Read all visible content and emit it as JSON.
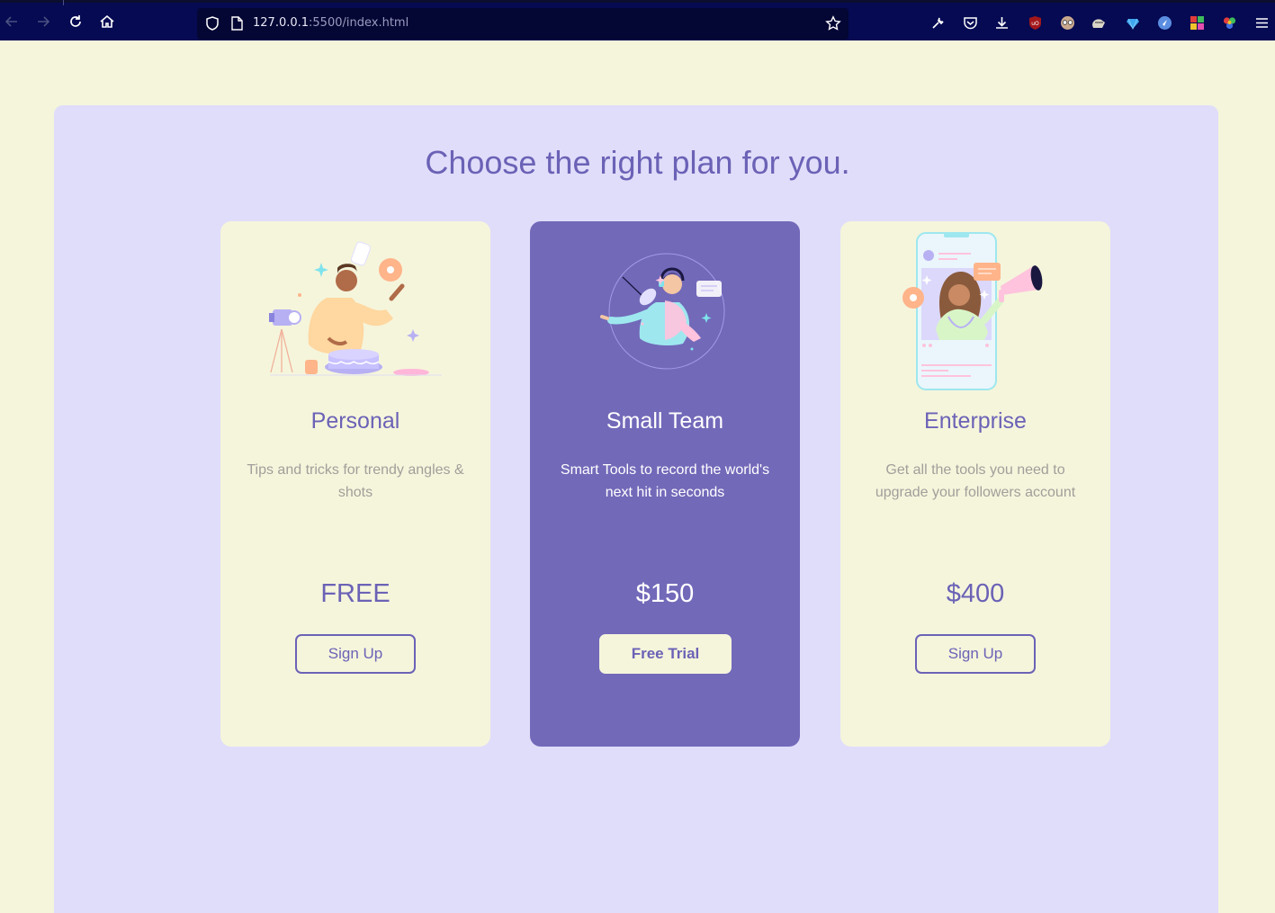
{
  "browser": {
    "url_host": "127.0.0.1",
    "url_rest": ":5500/index.html",
    "icons": [
      "back-icon",
      "forward-icon",
      "reload-icon",
      "home-icon",
      "shield-icon",
      "page-icon",
      "bookmark-star-icon",
      "wrench-icon",
      "pocket-icon",
      "download-icon",
      "ublock-icon",
      "ext-glasses-icon",
      "ext-helmet-icon",
      "ext-diamond-icon",
      "ext-compass-icon",
      "ext-grid-icon",
      "ext-color-wheel-icon",
      "menu-icon"
    ]
  },
  "page": {
    "heading": "Choose the right plan for you."
  },
  "plans": [
    {
      "title": "Personal",
      "description": "Tips and tricks for trendy angles & shots",
      "price": "FREE",
      "button": "Sign Up"
    },
    {
      "title": "Small Team",
      "description": "Smart Tools to record the world's next hit in seconds",
      "price": "$150",
      "button": "Free Trial"
    },
    {
      "title": "Enterprise",
      "description": "Get all the tools you need to upgrade your followers account",
      "price": "$400",
      "button": "Sign Up"
    }
  ],
  "colors": {
    "page_bg": "#f5f5dc",
    "panel_bg": "#e0ddfa",
    "accent": "#6b62b6",
    "featured_bg": "#7269b9",
    "muted_text": "#a29e9a",
    "toolbar_bg": "#050a52"
  }
}
